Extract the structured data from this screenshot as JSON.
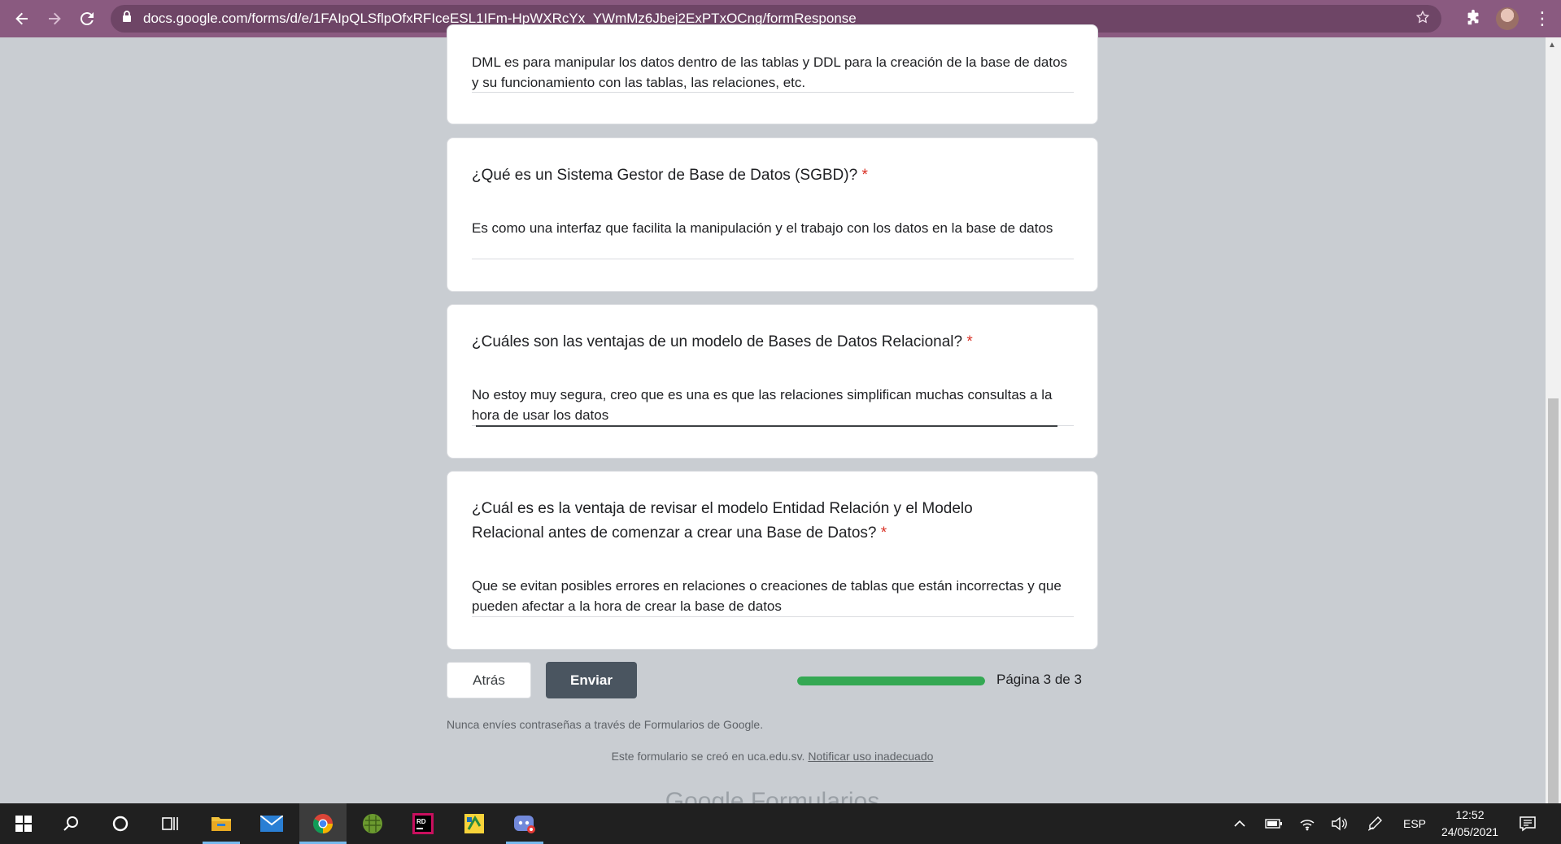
{
  "browser": {
    "url": "docs.google.com/forms/d/e/1FAIpQLSflpOfxRFIceESL1IFm-HpWXRcYx_YWmMz6Jbej2ExPTxOCng/formResponse",
    "icons": [
      "back-arrow-icon",
      "forward-arrow-icon",
      "reload-icon",
      "lock-icon",
      "star-icon",
      "puzzle-icon",
      "avatar",
      "kebab-menu-icon"
    ]
  },
  "form": {
    "cards": [
      {
        "question": "",
        "answer": "DML es para manipular los datos dentro de las tablas y DDL para la creación de la base de datos y su funcionamiento con las tablas, las relaciones, etc."
      },
      {
        "question": "¿Qué es un Sistema Gestor de Base de Datos (SGBD)?",
        "required_mark": "*",
        "answer": "Es como una interfaz que facilita la manipulación y el trabajo con los datos en la base de datos"
      },
      {
        "question": "¿Cuáles son las ventajas de un modelo de Bases de Datos Relacional?",
        "required_mark": "*",
        "answer": "No estoy muy segura, creo que es una es que las relaciones simplifican muchas consultas a la hora de usar los datos"
      },
      {
        "question": "¿Cuál es es la ventaja de revisar el modelo Entidad Relación y el Modelo Relacional antes de comenzar a crear una Base de Datos?",
        "required_mark": "*",
        "answer": "Que se evitan posibles errores en relaciones o creaciones de tablas que están incorrectas y que pueden afectar a la hora de crear la base de datos"
      }
    ],
    "back_label": "Atrás",
    "submit_label": "Enviar",
    "progress": {
      "fraction": 1.0,
      "label": "Página 3 de 3"
    },
    "password_notice": "Nunca envíes contraseñas a través de Formularios de Google.",
    "created_text": "Este formulario se creó en uca.edu.sv.",
    "report_link": "Notificar uso inadecuado",
    "logo_text": "Google Formularios",
    "colors": {
      "progress": "#34a853",
      "required": "#d93025",
      "submit_bg": "#4a5560",
      "browser_frame": "#8a5a80"
    }
  },
  "taskbar": {
    "apps": [
      "windows-start-icon",
      "search-icon",
      "cortana-icon",
      "task-view-icon",
      "file-explorer-icon",
      "mail-icon",
      "chrome-icon",
      "minecraft-icon",
      "rider-icon",
      "app-icon",
      "discord-icon"
    ],
    "tray": {
      "language": "ESP",
      "time": "12:52",
      "date": "24/05/2021"
    }
  }
}
